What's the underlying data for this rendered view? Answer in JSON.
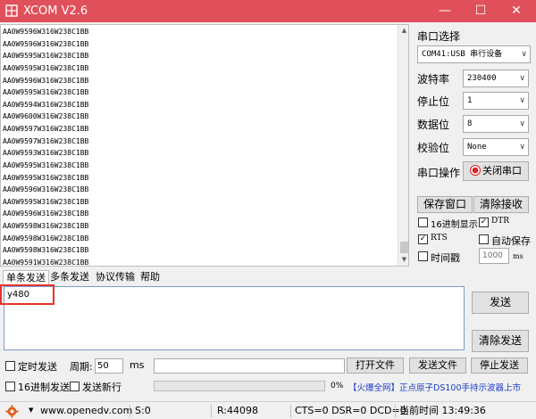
{
  "app": {
    "title": "XCOM V2.6"
  },
  "receive": {
    "lines": [
      "AA0W9596W316W238C1BB",
      "AA0W9596W316W238C1BB",
      "AA0W9595W316W238C1BB",
      "AA0W9595W316W238C1BB",
      "AA0W9596W316W238C1BB",
      "AA0W9595W316W238C1BB",
      "AA0W9594W316W238C1BB",
      "AA0W9600W316W238C1BB",
      "AA0W9597W316W238C1BB",
      "AA0W9597W316W238C1BB",
      "AA0W9593W316W238C1BB",
      "AA0W9595W316W238C1BB",
      "AA0W9595W316W238C1BB",
      "AA0W9596W316W238C1BB",
      "AA0W9595W316W238C1BB",
      "AA0W9596W316W238C1BB",
      "AA0W9598W316W238C1BB",
      "AA0W9598W316W238C1BB",
      "AA0W9598W316W238C1BB",
      "AA0W9591W316W238C1BB"
    ]
  },
  "port": {
    "section_label": "串口选择",
    "port_value": "COM41:USB 串行设备",
    "baud_label": "波特率",
    "baud_value": "230400",
    "stopbits_label": "停止位",
    "stopbits_value": "1",
    "databits_label": "数据位",
    "databits_value": "8",
    "parity_label": "校验位",
    "parity_value": "None",
    "op_label": "串口操作",
    "close_button": "关闭串口"
  },
  "options": {
    "save_window": "保存窗口",
    "clear_receive": "清除接收",
    "hex_display": "16进制显示",
    "dtr": "DTR",
    "rts": "RTS",
    "auto_save": "自动保存",
    "timestamp": "时间戳",
    "timestamp_value": "1000",
    "timestamp_unit": "ms",
    "hex_display_checked": false,
    "dtr_checked": true,
    "rts_checked": true,
    "auto_save_checked": false,
    "timestamp_checked": false
  },
  "tabs": [
    "单条发送",
    "多条发送",
    "协议传输",
    "帮助"
  ],
  "send": {
    "text": "y480",
    "send_button": "发送",
    "clear_send_button": "清除发送"
  },
  "bottom": {
    "timed_send": "定时发送",
    "period_label": "周期:",
    "period_value": "50",
    "period_unit": "ms",
    "open_file": "打开文件",
    "send_file": "发送文件",
    "stop_send": "停止发送",
    "hex_send": "16进制发送",
    "send_newline": "发送新行",
    "progress": "0%",
    "progress_value": 0,
    "promo_bracket": "【火爆全网】",
    "promo_text": "正点原子DS100手持示波器上市"
  },
  "status": {
    "url": "www.openedv.com",
    "s": "S:0",
    "r": "R:44098",
    "lines": "CTS=0 DSR=0 DCD=0",
    "time": "当前时间 13:49:36"
  },
  "colors": {
    "title_bar": "#e0505a",
    "highlight": "#e8322c",
    "link_blue": "#1a3cc8",
    "close_icon_red": "#e02020"
  }
}
